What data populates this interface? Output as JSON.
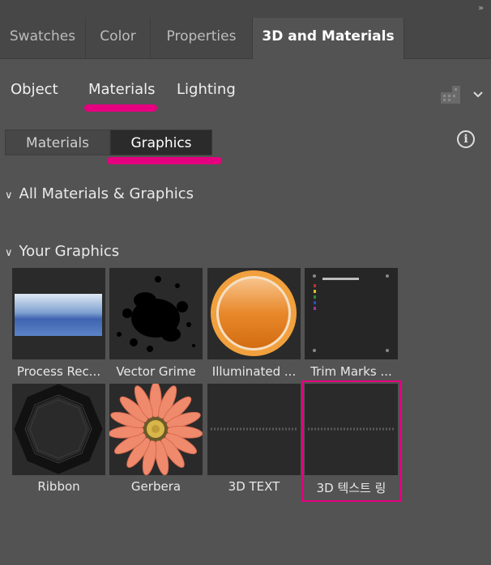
{
  "panel": {
    "collapse_glyph": "»",
    "tabs": [
      {
        "label": "Swatches"
      },
      {
        "label": "Color"
      },
      {
        "label": "Properties"
      },
      {
        "label": "3D and Materials"
      }
    ],
    "subnav": {
      "object": "Object",
      "materials": "Materials",
      "lighting": "Lighting"
    },
    "segmented": {
      "materials": "Materials",
      "graphics": "Graphics"
    },
    "sections": {
      "all": "All Materials & Graphics",
      "your": "Your Graphics"
    },
    "graphics": [
      {
        "label": "Process Rec..."
      },
      {
        "label": "Vector Grime"
      },
      {
        "label": "Illuminated ..."
      },
      {
        "label": "Trim Marks ..."
      },
      {
        "label": "Ribbon"
      },
      {
        "label": "Gerbera"
      },
      {
        "label": "3D TEXT"
      },
      {
        "label": "3D 텍스트 링"
      }
    ],
    "accent_color": "#e4007f"
  }
}
